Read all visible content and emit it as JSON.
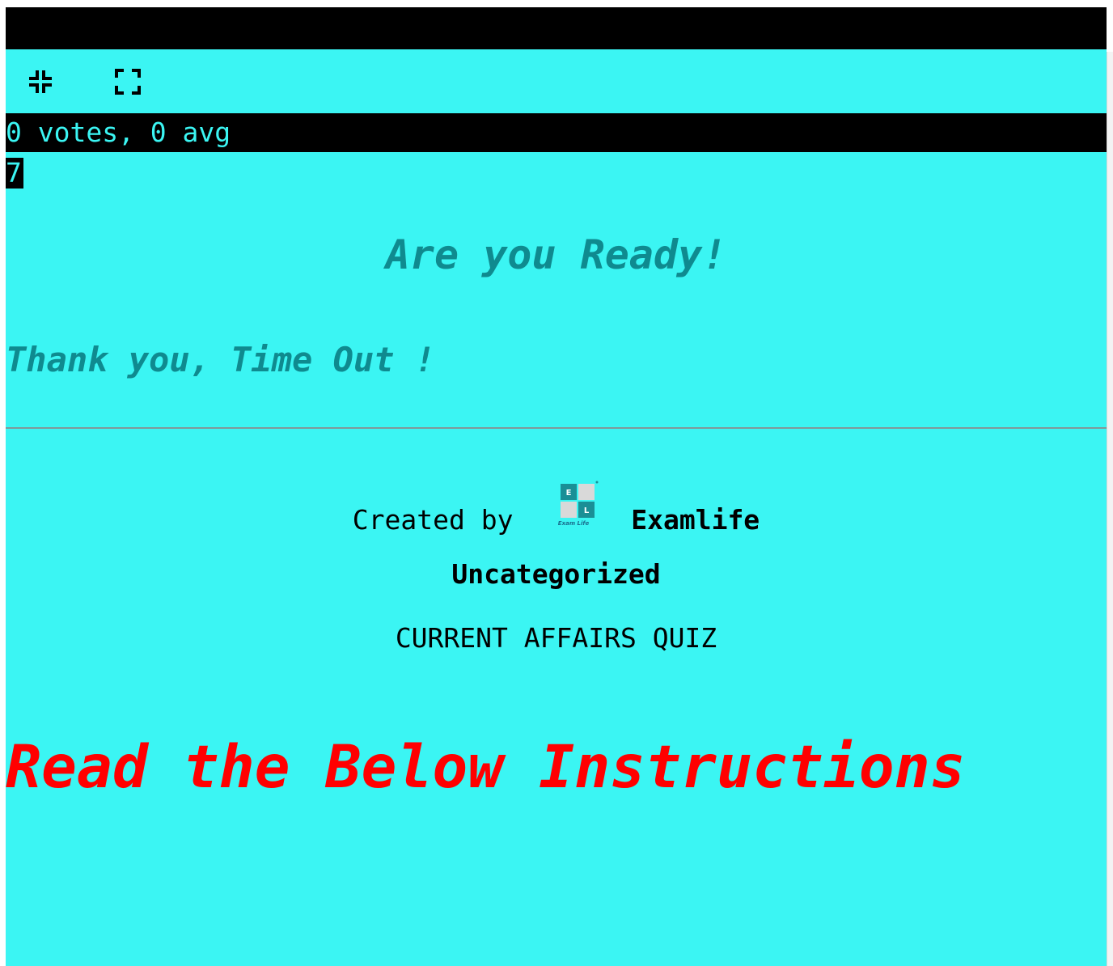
{
  "quiz": {
    "background_color": "#3bf5f3",
    "fullscreen": {
      "exit_icon": "fullscreen-exit-icon",
      "enter_icon": "fullscreen-enter-icon"
    },
    "rating_text": "0 votes, 0 avg",
    "timer_value": "7",
    "ready_heading": "Are you Ready!",
    "timeout_message": "Thank you, Time Out !",
    "creator": {
      "prefix": "Created by",
      "logo_icon": "examlife-logo-icon",
      "logo_letters": [
        "E",
        "L"
      ],
      "logo_caption": "Exam Life",
      "name": "Examlife"
    },
    "category": "Uncategorized",
    "title": "CURRENT AFFAIRS QUIZ",
    "instructions_heading": "Read the Below Instructions",
    "colors": {
      "heading_teal": "#0f8a8f",
      "instructions_red": "#ff0000",
      "bar_black": "#000000"
    }
  }
}
